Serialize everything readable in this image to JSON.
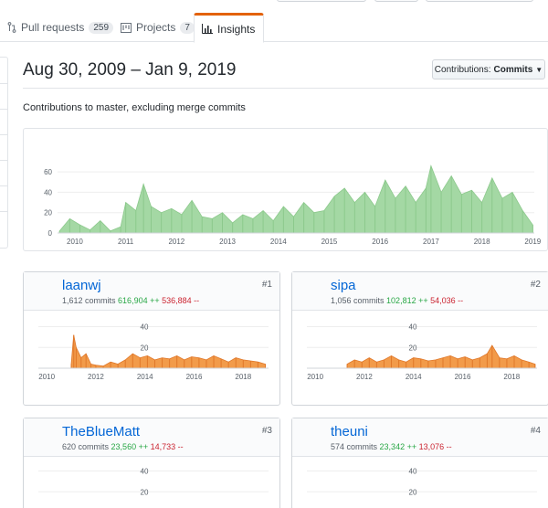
{
  "tabs": [
    {
      "label": "Pull requests",
      "count": "259",
      "icon": "pull-request-icon"
    },
    {
      "label": "Projects",
      "count": "7",
      "icon": "project-icon"
    },
    {
      "label": "Insights",
      "icon": "graph-icon",
      "selected": true
    }
  ],
  "header": {
    "date_range": "Aug 30, 2009 – Jan 9, 2019",
    "contrib_button_prefix": "Contributions:",
    "contrib_button_value": "Commits",
    "subtitle": "Contributions to master, excluding merge commits"
  },
  "colors": {
    "main_area": "#a4d8a4",
    "main_stroke": "#8cc98c",
    "contributor_area": "#f29b4a",
    "contributor_stroke": "#e0782a",
    "tab_accent": "#e36209",
    "link": "#0366d6"
  },
  "chart_data": [
    {
      "type": "area",
      "name_note": "",
      "x_ticks": [
        "2010",
        "2011",
        "2012",
        "2013",
        "2014",
        "2015",
        "2016",
        "2017",
        "2018",
        "2019"
      ],
      "x_range": [
        2009.66,
        2019.03
      ],
      "y_ticks": [
        0,
        20,
        40,
        60
      ],
      "y_range": [
        0,
        70
      ],
      "series_shape": "weekly commits",
      "x": [
        2009.7,
        2009.9,
        2010.1,
        2010.3,
        2010.5,
        2010.7,
        2010.9,
        2011.0,
        2011.2,
        2011.35,
        2011.5,
        2011.7,
        2011.9,
        2012.1,
        2012.3,
        2012.5,
        2012.7,
        2012.9,
        2013.1,
        2013.3,
        2013.5,
        2013.7,
        2013.9,
        2014.1,
        2014.3,
        2014.5,
        2014.7,
        2014.9,
        2015.1,
        2015.3,
        2015.5,
        2015.7,
        2015.9,
        2016.1,
        2016.3,
        2016.5,
        2016.7,
        2016.9,
        2017.0,
        2017.2,
        2017.4,
        2017.6,
        2017.8,
        2018.0,
        2018.2,
        2018.4,
        2018.6,
        2018.8,
        2019.0
      ],
      "y": [
        2,
        14,
        8,
        3,
        12,
        2,
        6,
        30,
        22,
        48,
        26,
        20,
        24,
        18,
        32,
        16,
        14,
        20,
        10,
        18,
        14,
        22,
        12,
        26,
        16,
        30,
        20,
        22,
        36,
        44,
        30,
        40,
        26,
        52,
        34,
        46,
        30,
        44,
        66,
        40,
        56,
        38,
        42,
        30,
        54,
        34,
        40,
        22,
        8
      ]
    },
    {
      "type": "area",
      "contributor": "laanwj",
      "x_ticks": [
        "2010",
        "2012",
        "2014",
        "2016",
        "2018"
      ],
      "x_range": [
        2009.66,
        2019.03
      ],
      "y_ticks": [
        20,
        40
      ],
      "y_range": [
        0,
        44
      ],
      "x": [
        2011.0,
        2011.1,
        2011.2,
        2011.4,
        2011.6,
        2011.8,
        2012.0,
        2012.3,
        2012.6,
        2012.9,
        2013.2,
        2013.5,
        2013.8,
        2014.1,
        2014.4,
        2014.7,
        2015.0,
        2015.3,
        2015.6,
        2015.9,
        2016.2,
        2016.5,
        2016.8,
        2017.1,
        2017.4,
        2017.7,
        2018.0,
        2018.3,
        2018.6,
        2018.9
      ],
      "y": [
        4,
        32,
        20,
        10,
        14,
        4,
        3,
        2,
        6,
        4,
        8,
        14,
        10,
        12,
        8,
        10,
        9,
        12,
        8,
        11,
        10,
        8,
        12,
        9,
        6,
        10,
        8,
        7,
        6,
        4
      ]
    },
    {
      "type": "area",
      "contributor": "sipa",
      "x_ticks": [
        "2010",
        "2012",
        "2014",
        "2016",
        "2018"
      ],
      "x_range": [
        2009.66,
        2019.03
      ],
      "y_ticks": [
        20,
        40
      ],
      "y_range": [
        0,
        44
      ],
      "x": [
        2011.3,
        2011.6,
        2011.9,
        2012.2,
        2012.5,
        2012.8,
        2013.1,
        2013.4,
        2013.7,
        2014.0,
        2014.3,
        2014.6,
        2014.9,
        2015.2,
        2015.5,
        2015.8,
        2016.1,
        2016.4,
        2016.7,
        2017.0,
        2017.2,
        2017.5,
        2017.8,
        2018.1,
        2018.4,
        2018.7,
        2018.95
      ],
      "y": [
        4,
        8,
        6,
        10,
        6,
        8,
        12,
        8,
        6,
        10,
        9,
        7,
        8,
        10,
        12,
        9,
        11,
        8,
        10,
        14,
        22,
        10,
        9,
        12,
        8,
        6,
        4
      ]
    },
    {
      "type": "area",
      "contributor": "TheBlueMatt",
      "y_ticks": [
        20,
        40
      ],
      "y_range": [
        0,
        44
      ]
    },
    {
      "type": "area",
      "contributor": "theuni",
      "y_ticks": [
        20,
        40
      ],
      "y_range": [
        0,
        44
      ]
    }
  ],
  "contributors": [
    {
      "name": "laanwj",
      "rank": "#1",
      "commits": "1,612 commits",
      "additions": "616,904 ++",
      "deletions": "536,884 --",
      "avatar": "pixel-avatar-laanwj"
    },
    {
      "name": "sipa",
      "rank": "#2",
      "commits": "1,056 commits",
      "additions": "102,812 ++",
      "deletions": "54,036 --",
      "avatar": "photo-avatar-sipa"
    },
    {
      "name": "TheBlueMatt",
      "rank": "#3",
      "commits": "620 commits",
      "additions": "23,560 ++",
      "deletions": "14,733 --",
      "avatar": "pixel-avatar-thebluematt"
    },
    {
      "name": "theuni",
      "rank": "#4",
      "commits": "574 commits",
      "additions": "23,342 ++",
      "deletions": "13,076 --",
      "avatar": "pixel-avatar-theuni"
    }
  ]
}
